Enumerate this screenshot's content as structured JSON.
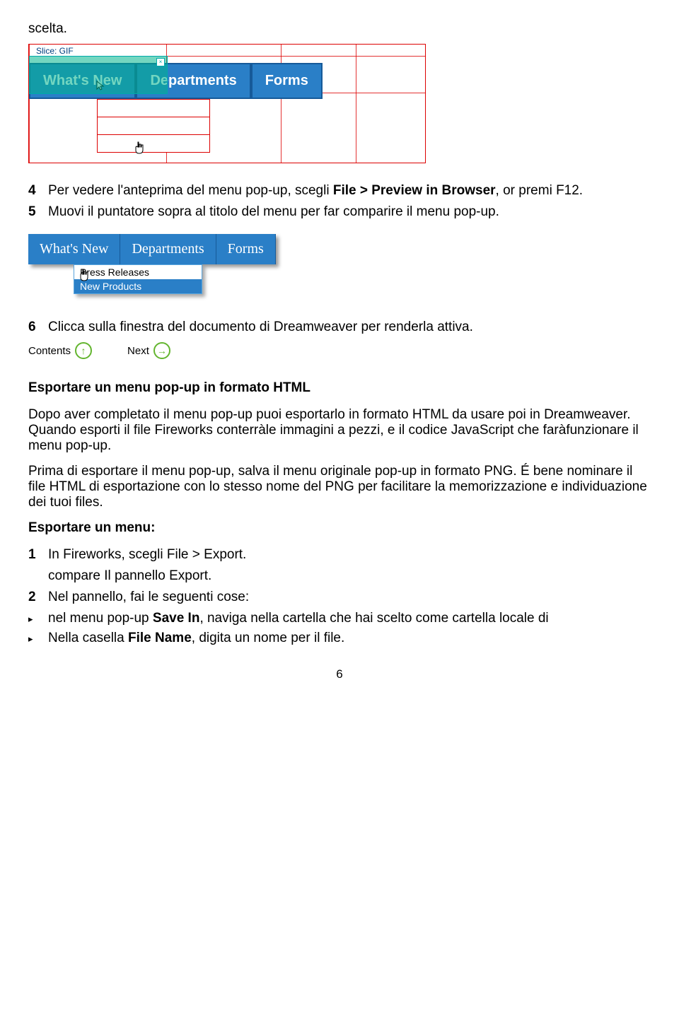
{
  "top_word": "scelta.",
  "fig1": {
    "slice_label": "Slice: GIF",
    "tabs": [
      "What's New",
      "Departments",
      "Forms"
    ]
  },
  "steps_a": [
    {
      "n": "4",
      "pre": "Per vedere l'anteprima del menu pop-up, scegli ",
      "bold": "File > Preview in Browser",
      "post": ", or premi F12."
    },
    {
      "n": "5",
      "pre": "Muovi il puntatore sopra al titolo del menu per far comparire il menu pop-up.",
      "bold": "",
      "post": ""
    }
  ],
  "fig2": {
    "tabs": [
      "What's New",
      "Departments",
      "Forms"
    ],
    "popup": [
      "Press Releases",
      "New Products"
    ]
  },
  "steps_b": [
    {
      "n": "6",
      "pre": "Clicca sulla finestra del documento di Dreamweaver per renderla attiva.",
      "bold": "",
      "post": ""
    }
  ],
  "navlinks": {
    "contents": "Contents",
    "next": "Next"
  },
  "section2_title": "Esportare un menu pop-up in formato HTML",
  "para1": "Dopo aver completato il menu pop-up puoi esportarlo in formato HTML da usare poi in Dreamweaver. Quando esporti il  file Fireworks conterràle immagini a pezzi, e il codice JavaScript che faràfunzionare il menu pop-up.",
  "para2": "Prima di esportare il menu pop-up, salva il menu originale pop-up in formato PNG. É bene nominare il file HTML di esportazione con lo stesso nome del PNG per facilitare la memorizzazione e individuazione dei tuoi files.",
  "export_heading": "Esportare un menu:",
  "steps_c": {
    "s1_n": "1",
    "s1a": "In Fireworks, scegli File > Export.",
    "s1b": "compare Il pannello Export.",
    "s2_n": "2",
    "s2": "Nel pannello, fai le seguenti cose:"
  },
  "bullets": [
    {
      "pre": "nel menu pop-up ",
      "bold": "Save In",
      "post": ", naviga nella cartella che hai scelto come cartella locale di"
    },
    {
      "pre": "Nella casella ",
      "bold": "File Name",
      "post": ", digita un nome per il file."
    }
  ],
  "page_number": "6"
}
